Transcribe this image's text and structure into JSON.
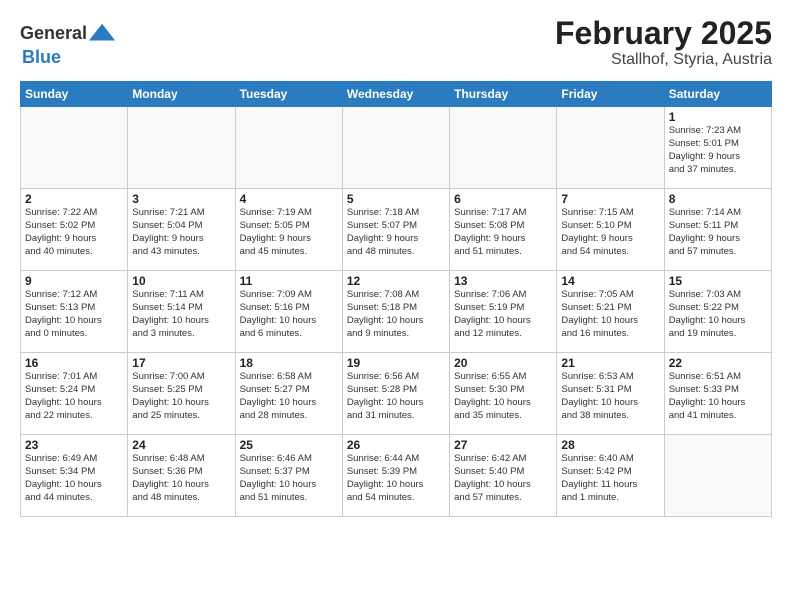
{
  "header": {
    "logo_general": "General",
    "logo_blue": "Blue",
    "month_title": "February 2025",
    "location": "Stallhof, Styria, Austria"
  },
  "weekdays": [
    "Sunday",
    "Monday",
    "Tuesday",
    "Wednesday",
    "Thursday",
    "Friday",
    "Saturday"
  ],
  "weeks": [
    [
      {
        "day": "",
        "info": ""
      },
      {
        "day": "",
        "info": ""
      },
      {
        "day": "",
        "info": ""
      },
      {
        "day": "",
        "info": ""
      },
      {
        "day": "",
        "info": ""
      },
      {
        "day": "",
        "info": ""
      },
      {
        "day": "1",
        "info": "Sunrise: 7:23 AM\nSunset: 5:01 PM\nDaylight: 9 hours\nand 37 minutes."
      }
    ],
    [
      {
        "day": "2",
        "info": "Sunrise: 7:22 AM\nSunset: 5:02 PM\nDaylight: 9 hours\nand 40 minutes."
      },
      {
        "day": "3",
        "info": "Sunrise: 7:21 AM\nSunset: 5:04 PM\nDaylight: 9 hours\nand 43 minutes."
      },
      {
        "day": "4",
        "info": "Sunrise: 7:19 AM\nSunset: 5:05 PM\nDaylight: 9 hours\nand 45 minutes."
      },
      {
        "day": "5",
        "info": "Sunrise: 7:18 AM\nSunset: 5:07 PM\nDaylight: 9 hours\nand 48 minutes."
      },
      {
        "day": "6",
        "info": "Sunrise: 7:17 AM\nSunset: 5:08 PM\nDaylight: 9 hours\nand 51 minutes."
      },
      {
        "day": "7",
        "info": "Sunrise: 7:15 AM\nSunset: 5:10 PM\nDaylight: 9 hours\nand 54 minutes."
      },
      {
        "day": "8",
        "info": "Sunrise: 7:14 AM\nSunset: 5:11 PM\nDaylight: 9 hours\nand 57 minutes."
      }
    ],
    [
      {
        "day": "9",
        "info": "Sunrise: 7:12 AM\nSunset: 5:13 PM\nDaylight: 10 hours\nand 0 minutes."
      },
      {
        "day": "10",
        "info": "Sunrise: 7:11 AM\nSunset: 5:14 PM\nDaylight: 10 hours\nand 3 minutes."
      },
      {
        "day": "11",
        "info": "Sunrise: 7:09 AM\nSunset: 5:16 PM\nDaylight: 10 hours\nand 6 minutes."
      },
      {
        "day": "12",
        "info": "Sunrise: 7:08 AM\nSunset: 5:18 PM\nDaylight: 10 hours\nand 9 minutes."
      },
      {
        "day": "13",
        "info": "Sunrise: 7:06 AM\nSunset: 5:19 PM\nDaylight: 10 hours\nand 12 minutes."
      },
      {
        "day": "14",
        "info": "Sunrise: 7:05 AM\nSunset: 5:21 PM\nDaylight: 10 hours\nand 16 minutes."
      },
      {
        "day": "15",
        "info": "Sunrise: 7:03 AM\nSunset: 5:22 PM\nDaylight: 10 hours\nand 19 minutes."
      }
    ],
    [
      {
        "day": "16",
        "info": "Sunrise: 7:01 AM\nSunset: 5:24 PM\nDaylight: 10 hours\nand 22 minutes."
      },
      {
        "day": "17",
        "info": "Sunrise: 7:00 AM\nSunset: 5:25 PM\nDaylight: 10 hours\nand 25 minutes."
      },
      {
        "day": "18",
        "info": "Sunrise: 6:58 AM\nSunset: 5:27 PM\nDaylight: 10 hours\nand 28 minutes."
      },
      {
        "day": "19",
        "info": "Sunrise: 6:56 AM\nSunset: 5:28 PM\nDaylight: 10 hours\nand 31 minutes."
      },
      {
        "day": "20",
        "info": "Sunrise: 6:55 AM\nSunset: 5:30 PM\nDaylight: 10 hours\nand 35 minutes."
      },
      {
        "day": "21",
        "info": "Sunrise: 6:53 AM\nSunset: 5:31 PM\nDaylight: 10 hours\nand 38 minutes."
      },
      {
        "day": "22",
        "info": "Sunrise: 6:51 AM\nSunset: 5:33 PM\nDaylight: 10 hours\nand 41 minutes."
      }
    ],
    [
      {
        "day": "23",
        "info": "Sunrise: 6:49 AM\nSunset: 5:34 PM\nDaylight: 10 hours\nand 44 minutes."
      },
      {
        "day": "24",
        "info": "Sunrise: 6:48 AM\nSunset: 5:36 PM\nDaylight: 10 hours\nand 48 minutes."
      },
      {
        "day": "25",
        "info": "Sunrise: 6:46 AM\nSunset: 5:37 PM\nDaylight: 10 hours\nand 51 minutes."
      },
      {
        "day": "26",
        "info": "Sunrise: 6:44 AM\nSunset: 5:39 PM\nDaylight: 10 hours\nand 54 minutes."
      },
      {
        "day": "27",
        "info": "Sunrise: 6:42 AM\nSunset: 5:40 PM\nDaylight: 10 hours\nand 57 minutes."
      },
      {
        "day": "28",
        "info": "Sunrise: 6:40 AM\nSunset: 5:42 PM\nDaylight: 11 hours\nand 1 minute."
      },
      {
        "day": "",
        "info": ""
      }
    ]
  ]
}
